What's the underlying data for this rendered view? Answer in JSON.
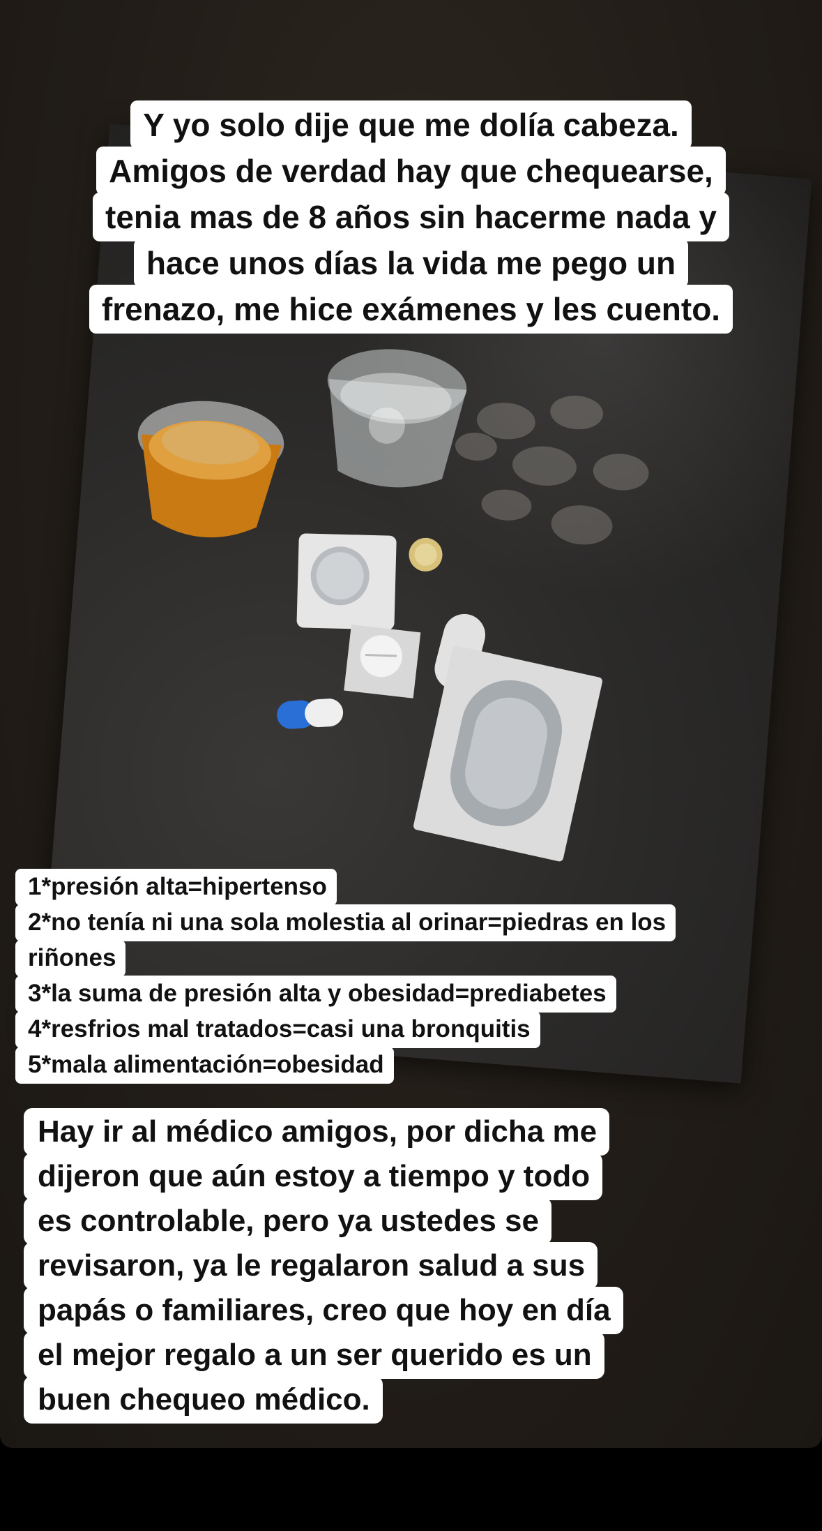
{
  "story": {
    "top_caption": [
      "Y yo solo dije que me dolía cabeza.",
      "Amigos de verdad hay que chequearse,",
      "tenia mas de 8 años sin hacerme nada y",
      "hace unos días la vida me pego un",
      "frenazo, me hice exámenes y les cuento."
    ],
    "list_caption": [
      "1*presión alta=hipertenso",
      "2*no tenía ni una sola molestia al orinar=piedras en los",
      "riñones",
      "3*la suma de presión alta y obesidad=prediabetes",
      "4*resfrios mal tratados=casi una bronquitis",
      "5*mala alimentación=obesidad"
    ],
    "bottom_caption": [
      "Hay ir al médico amigos, por dicha me",
      "dijeron que aún estoy a tiempo y todo",
      "es controlable,  pero ya ustedes se",
      "revisaron, ya le regalaron salud a sus",
      "papás o familiares, creo que hoy en día",
      "el mejor regalo a un ser querido es un",
      "buen chequeo médico."
    ]
  },
  "colors": {
    "caption_bg": "#ffffff",
    "caption_text": "#111111",
    "background": "#221d18"
  }
}
